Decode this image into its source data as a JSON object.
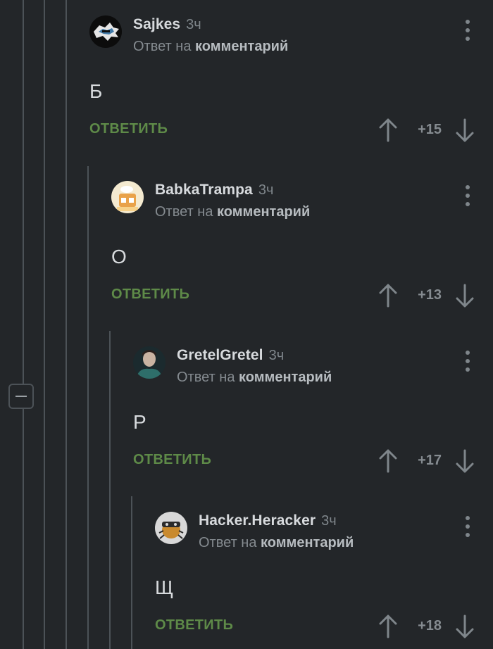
{
  "collapse_control": {
    "icon": "minus-icon"
  },
  "comments": [
    {
      "author": "Sajkes",
      "time": "3ч",
      "reply_prefix": "Ответ на",
      "reply_link": "комментарий",
      "body": "Б",
      "reply_label": "ОТВЕТИТЬ",
      "rating": "+15"
    },
    {
      "author": "BabkaTrampa",
      "time": "3ч",
      "reply_prefix": "Ответ на",
      "reply_link": "комментарий",
      "body": "О",
      "reply_label": "ОТВЕТИТЬ",
      "rating": "+13"
    },
    {
      "author": "GretelGretel",
      "time": "3ч",
      "reply_prefix": "Ответ на",
      "reply_link": "комментарий",
      "body": "Р",
      "reply_label": "ОТВЕТИТЬ",
      "rating": "+17"
    },
    {
      "author": "Hacker.Heracker",
      "time": "3ч",
      "reply_prefix": "Ответ на",
      "reply_link": "комментарий",
      "body": "Щ",
      "reply_label": "ОТВЕТИТЬ",
      "rating": "+18"
    }
  ],
  "colors": {
    "background": "#232629",
    "reply_button": "#5e8a48",
    "thread_line": "#4c5257"
  }
}
